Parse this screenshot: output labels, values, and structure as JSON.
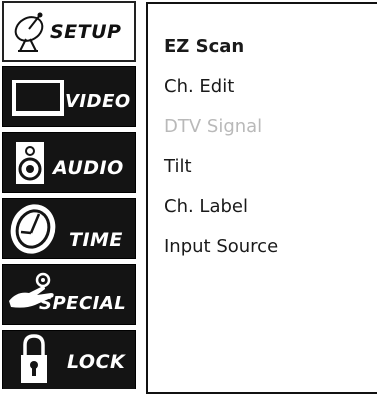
{
  "sidebar": {
    "tabs": [
      {
        "label": "SETUP",
        "icon": "satellite-dish-icon",
        "selected": true
      },
      {
        "label": "VIDEO",
        "icon": "tv-screen-icon",
        "selected": false
      },
      {
        "label": "AUDIO",
        "icon": "speaker-icon",
        "selected": false
      },
      {
        "label": "TIME",
        "icon": "clock-icon",
        "selected": false
      },
      {
        "label": "SPECIAL",
        "icon": "special-hand-icon",
        "selected": false
      },
      {
        "label": "LOCK",
        "icon": "padlock-icon",
        "selected": false
      }
    ]
  },
  "menu": {
    "items": [
      {
        "label": "EZ Scan",
        "state": "selected"
      },
      {
        "label": "Ch. Edit",
        "state": "normal"
      },
      {
        "label": "DTV Signal",
        "state": "disabled"
      },
      {
        "label": "Tilt",
        "state": "normal"
      },
      {
        "label": "Ch. Label",
        "state": "normal"
      },
      {
        "label": "Input Source",
        "state": "normal"
      }
    ]
  }
}
